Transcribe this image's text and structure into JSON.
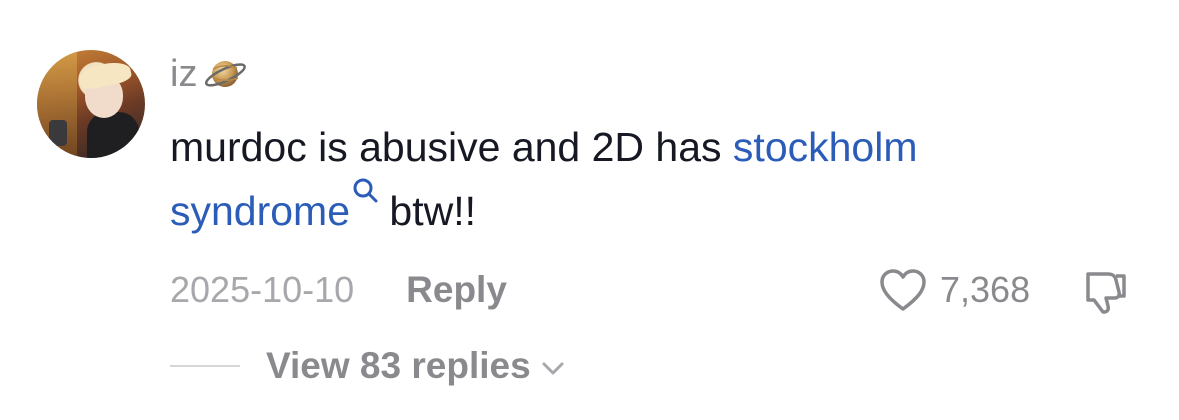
{
  "comment": {
    "username": "iz",
    "username_icon": "ringed-planet-emoji",
    "text_part1": "murdoc is abusive and 2D has ",
    "keyword": "stockholm syndrome",
    "text_part2": " btw!!",
    "timestamp": "2025-10-10",
    "reply_label": "Reply",
    "like_count": "7,368",
    "view_replies_label": "View 83 replies"
  },
  "colors": {
    "keyword": "#2b5db8",
    "secondary_text": "#8a8a8e",
    "primary_text": "#161823"
  },
  "icons": {
    "search": "search-icon",
    "heart": "heart-icon",
    "dislike": "thumbs-down-icon",
    "chevron": "chevron-down-icon"
  }
}
